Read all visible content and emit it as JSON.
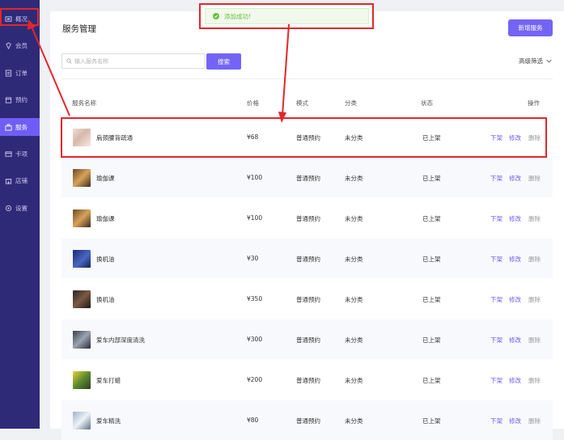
{
  "sidebar": {
    "items": [
      {
        "label": "概况",
        "icon": "monitor-icon"
      },
      {
        "label": "会员",
        "icon": "diamond-icon"
      },
      {
        "label": "订单",
        "icon": "order-icon"
      },
      {
        "label": "预约",
        "icon": "calendar-icon"
      },
      {
        "label": "服务",
        "icon": "service-icon",
        "active": true
      },
      {
        "label": "卡项",
        "icon": "card-icon"
      },
      {
        "label": "店铺",
        "icon": "store-icon"
      },
      {
        "label": "设置",
        "icon": "gear-icon"
      }
    ]
  },
  "header": {
    "title": "服务管理",
    "add_button": "新增服务"
  },
  "search": {
    "placeholder": "输入服务名称",
    "button": "搜索",
    "advanced": "高级筛选"
  },
  "table": {
    "columns": [
      "服务名称",
      "价格",
      "模式",
      "分类",
      "状态",
      "操作"
    ],
    "rows": [
      {
        "name": "肩颈腰背疏通",
        "price": "¥68",
        "mode": "普通预约",
        "category": "未分类",
        "status": "已上架"
      },
      {
        "name": "瑜伽课",
        "price": "¥100",
        "mode": "普通预约",
        "category": "未分类",
        "status": "已上架"
      },
      {
        "name": "瑜伽课",
        "price": "¥100",
        "mode": "普通预约",
        "category": "未分类",
        "status": "已上架"
      },
      {
        "name": "换机油",
        "price": "¥30",
        "mode": "普通预约",
        "category": "未分类",
        "status": "已上架"
      },
      {
        "name": "换机油",
        "price": "¥350",
        "mode": "普通预约",
        "category": "未分类",
        "status": "已上架"
      },
      {
        "name": "爱车内部深度清洗",
        "price": "¥300",
        "mode": "普通预约",
        "category": "未分类",
        "status": "已上架"
      },
      {
        "name": "爱车打蜡",
        "price": "¥200",
        "mode": "普通预约",
        "category": "未分类",
        "status": "已上架"
      },
      {
        "name": "爱车精洗",
        "price": "¥80",
        "mode": "普通预约",
        "category": "未分类",
        "status": "已上架"
      }
    ],
    "actions": {
      "offline": "下架",
      "edit": "修改",
      "delete": "删除"
    }
  },
  "toast": {
    "message": "添加成功!"
  },
  "colors": {
    "sidebar_bg": "#2f2a78",
    "accent": "#7464f5",
    "annotation_red": "#e3262a",
    "success_green": "#67c23a"
  }
}
